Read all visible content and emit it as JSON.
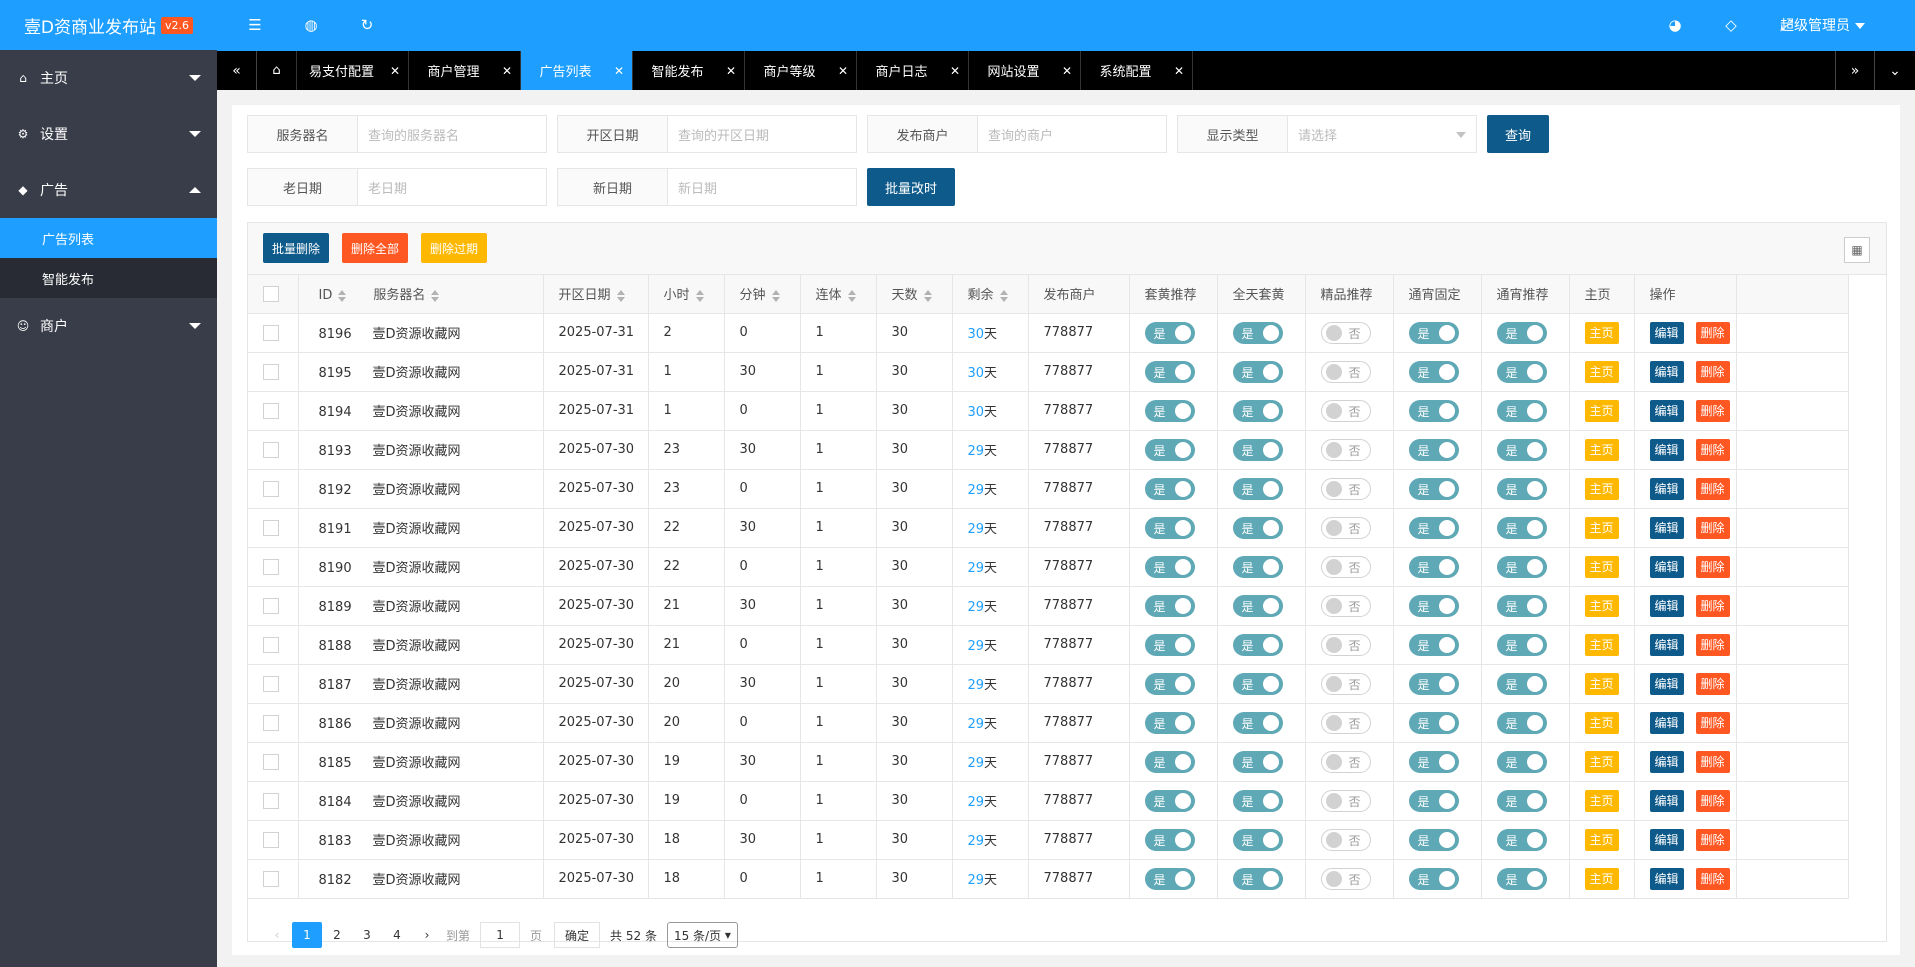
{
  "brand": {
    "name": "壹D资商业发布站",
    "version": "v2.6"
  },
  "sidebar": {
    "items": [
      {
        "label": "主页",
        "icon": "home-icon"
      },
      {
        "label": "设置",
        "icon": "gear-icon"
      },
      {
        "label": "广告",
        "icon": "diamond-icon"
      },
      {
        "label": "商户",
        "icon": "user-icon"
      }
    ],
    "sub_items": [
      "广告列表",
      "智能发布"
    ]
  },
  "header": {
    "admin_label": "超级管理员"
  },
  "tabs": [
    "易支付配置",
    "商户管理",
    "广告列表",
    "智能发布",
    "商户等级",
    "商户日志",
    "网站设置",
    "系统配置"
  ],
  "filters": {
    "server_label": "服务器名",
    "server_placeholder": "查询的服务器名",
    "open_label": "开区日期",
    "open_placeholder": "查询的开区日期",
    "merchant_label": "发布商户",
    "merchant_placeholder": "查询的商户",
    "display_label": "显示类型",
    "display_placeholder": "请选择",
    "query_btn": "查询",
    "old_label": "老日期",
    "old_placeholder": "老日期",
    "new_label": "新日期",
    "new_placeholder": "新日期",
    "batch_btn": "批量改时"
  },
  "toolbar": {
    "batch_delete": "批量删除",
    "delete_all": "删除全部",
    "delete_expired": "删除过期"
  },
  "table": {
    "headers": [
      "ID",
      "服务器名",
      "开区日期",
      "小时",
      "分钟",
      "连体",
      "天数",
      "剩余",
      "发布商户",
      "套黄推荐",
      "全天套黄",
      "精品推荐",
      "通宵固定",
      "通宵推荐",
      "主页",
      "操作"
    ],
    "rows": [
      {
        "id": "8196",
        "server": "壹D资源收藏网",
        "date": "2025-07-31",
        "hour": "2",
        "minute": "0",
        "lian": "1",
        "days": "30",
        "remain": "30",
        "merchant": "778877"
      },
      {
        "id": "8195",
        "server": "壹D资源收藏网",
        "date": "2025-07-31",
        "hour": "1",
        "minute": "30",
        "lian": "1",
        "days": "30",
        "remain": "30",
        "merchant": "778877"
      },
      {
        "id": "8194",
        "server": "壹D资源收藏网",
        "date": "2025-07-31",
        "hour": "1",
        "minute": "0",
        "lian": "1",
        "days": "30",
        "remain": "30",
        "merchant": "778877"
      },
      {
        "id": "8193",
        "server": "壹D资源收藏网",
        "date": "2025-07-30",
        "hour": "23",
        "minute": "30",
        "lian": "1",
        "days": "30",
        "remain": "29",
        "merchant": "778877"
      },
      {
        "id": "8192",
        "server": "壹D资源收藏网",
        "date": "2025-07-30",
        "hour": "23",
        "minute": "0",
        "lian": "1",
        "days": "30",
        "remain": "29",
        "merchant": "778877"
      },
      {
        "id": "8191",
        "server": "壹D资源收藏网",
        "date": "2025-07-30",
        "hour": "22",
        "minute": "30",
        "lian": "1",
        "days": "30",
        "remain": "29",
        "merchant": "778877"
      },
      {
        "id": "8190",
        "server": "壹D资源收藏网",
        "date": "2025-07-30",
        "hour": "22",
        "minute": "0",
        "lian": "1",
        "days": "30",
        "remain": "29",
        "merchant": "778877"
      },
      {
        "id": "8189",
        "server": "壹D资源收藏网",
        "date": "2025-07-30",
        "hour": "21",
        "minute": "30",
        "lian": "1",
        "days": "30",
        "remain": "29",
        "merchant": "778877"
      },
      {
        "id": "8188",
        "server": "壹D资源收藏网",
        "date": "2025-07-30",
        "hour": "21",
        "minute": "0",
        "lian": "1",
        "days": "30",
        "remain": "29",
        "merchant": "778877"
      },
      {
        "id": "8187",
        "server": "壹D资源收藏网",
        "date": "2025-07-30",
        "hour": "20",
        "minute": "30",
        "lian": "1",
        "days": "30",
        "remain": "29",
        "merchant": "778877"
      },
      {
        "id": "8186",
        "server": "壹D资源收藏网",
        "date": "2025-07-30",
        "hour": "20",
        "minute": "0",
        "lian": "1",
        "days": "30",
        "remain": "29",
        "merchant": "778877"
      },
      {
        "id": "8185",
        "server": "壹D资源收藏网",
        "date": "2025-07-30",
        "hour": "19",
        "minute": "30",
        "lian": "1",
        "days": "30",
        "remain": "29",
        "merchant": "778877"
      },
      {
        "id": "8184",
        "server": "壹D资源收藏网",
        "date": "2025-07-30",
        "hour": "19",
        "minute": "0",
        "lian": "1",
        "days": "30",
        "remain": "29",
        "merchant": "778877"
      },
      {
        "id": "8183",
        "server": "壹D资源收藏网",
        "date": "2025-07-30",
        "hour": "18",
        "minute": "30",
        "lian": "1",
        "days": "30",
        "remain": "29",
        "merchant": "778877"
      },
      {
        "id": "8182",
        "server": "壹D资源收藏网",
        "date": "2025-07-30",
        "hour": "18",
        "minute": "0",
        "lian": "1",
        "days": "30",
        "remain": "29",
        "merchant": "778877"
      }
    ],
    "day_suffix": "天",
    "switch_on": "是",
    "switch_off": "否",
    "homepage_btn": "主页",
    "edit_btn": "编辑",
    "delete_btn": "删除"
  },
  "pager": {
    "pages": [
      "1",
      "2",
      "3",
      "4"
    ],
    "goto_label": "到第",
    "goto_value": "1",
    "page_unit": "页",
    "confirm": "确定",
    "total": "共 52 条",
    "page_size": "15 条/页"
  },
  "colors": {
    "accent": "#1e9fff",
    "sidebar": "#393d49",
    "danger": "#ff5722",
    "warning": "#ffb800",
    "primary_dark": "#0e5a8a",
    "switch_on": "#5fa8b5"
  }
}
